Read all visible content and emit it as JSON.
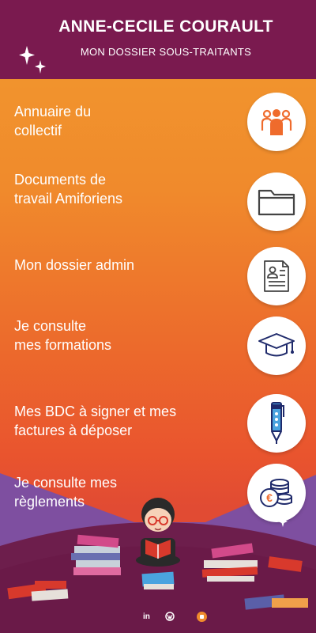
{
  "header": {
    "title": "ANNE-CECILE COURAULT",
    "subtitle": "MON DOSSIER SOUS-TRAITANTS"
  },
  "menu": [
    {
      "label": "Annuaire  du\ncollectif",
      "icon": "people-group-icon"
    },
    {
      "label": "Documents de\ntravail Amiforiens",
      "icon": "folder-icon"
    },
    {
      "label": "Mon dossier admin",
      "icon": "id-document-icon"
    },
    {
      "label": "Je consulte\nmes formations",
      "icon": "graduation-cap-icon"
    },
    {
      "label": "Mes BDC à signer et mes\nfactures à déposer",
      "icon": "pen-icon"
    },
    {
      "label": "Je consulte mes\nrèglements",
      "icon": "euro-coins-icon"
    }
  ],
  "footer": {
    "linkedin": "in"
  },
  "colors": {
    "header_bg": "#7a1a4f",
    "icon_orange": "#ef6b2c",
    "icon_navy": "#1f2a6b",
    "purple": "#7e4fa0"
  }
}
